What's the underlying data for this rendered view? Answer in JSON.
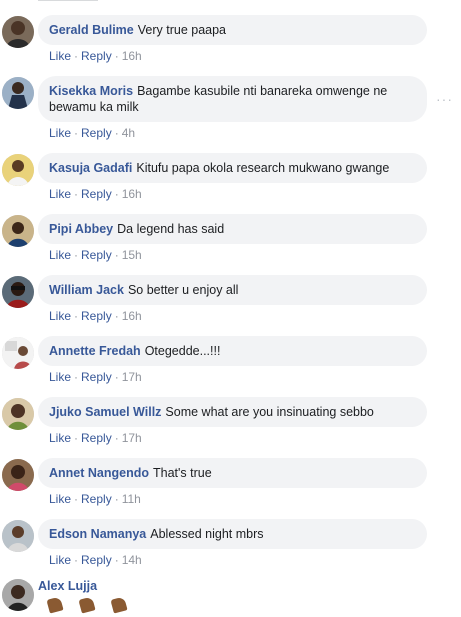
{
  "labels": {
    "like": "Like",
    "reply": "Reply",
    "dot": "·",
    "more": "···"
  },
  "comments": [
    {
      "author": "Gerald Bulime",
      "text": "Very true paapa",
      "time": "16h",
      "avatar": "avatar-gerald"
    },
    {
      "author": "Kisekka Moris",
      "text": "Bagambe kasubile nti banareka omwenge ne bewamu ka milk",
      "time": "4h",
      "avatar": "avatar-kisekka"
    },
    {
      "author": "Kasuja Gadafi",
      "text": "Kitufu papa okola research mukwano gwange",
      "time": "16h",
      "avatar": "avatar-kasuja"
    },
    {
      "author": "Pipi Abbey",
      "text": "Da legend has said",
      "time": "15h",
      "avatar": "avatar-pipi"
    },
    {
      "author": "William Jack",
      "text": "So better u enjoy all",
      "time": "16h",
      "avatar": "avatar-william"
    },
    {
      "author": "Annette Fredah",
      "text": "Otegedde...!!!",
      "time": "17h",
      "avatar": "avatar-annette"
    },
    {
      "author": "Jjuko Samuel Willz",
      "text": "Some what are you insinuating sebbo",
      "time": "17h",
      "avatar": "avatar-jjuko"
    },
    {
      "author": "Annet Nangendo",
      "text": "That's true",
      "time": "11h",
      "avatar": "avatar-annet"
    },
    {
      "author": "Edson Namanya",
      "text": "Ablessed night mbrs",
      "time": "14h",
      "avatar": "avatar-edson"
    }
  ],
  "last_comment": {
    "author": "Alex Lujja",
    "emoji_icon": "clapping-hands-icon"
  }
}
